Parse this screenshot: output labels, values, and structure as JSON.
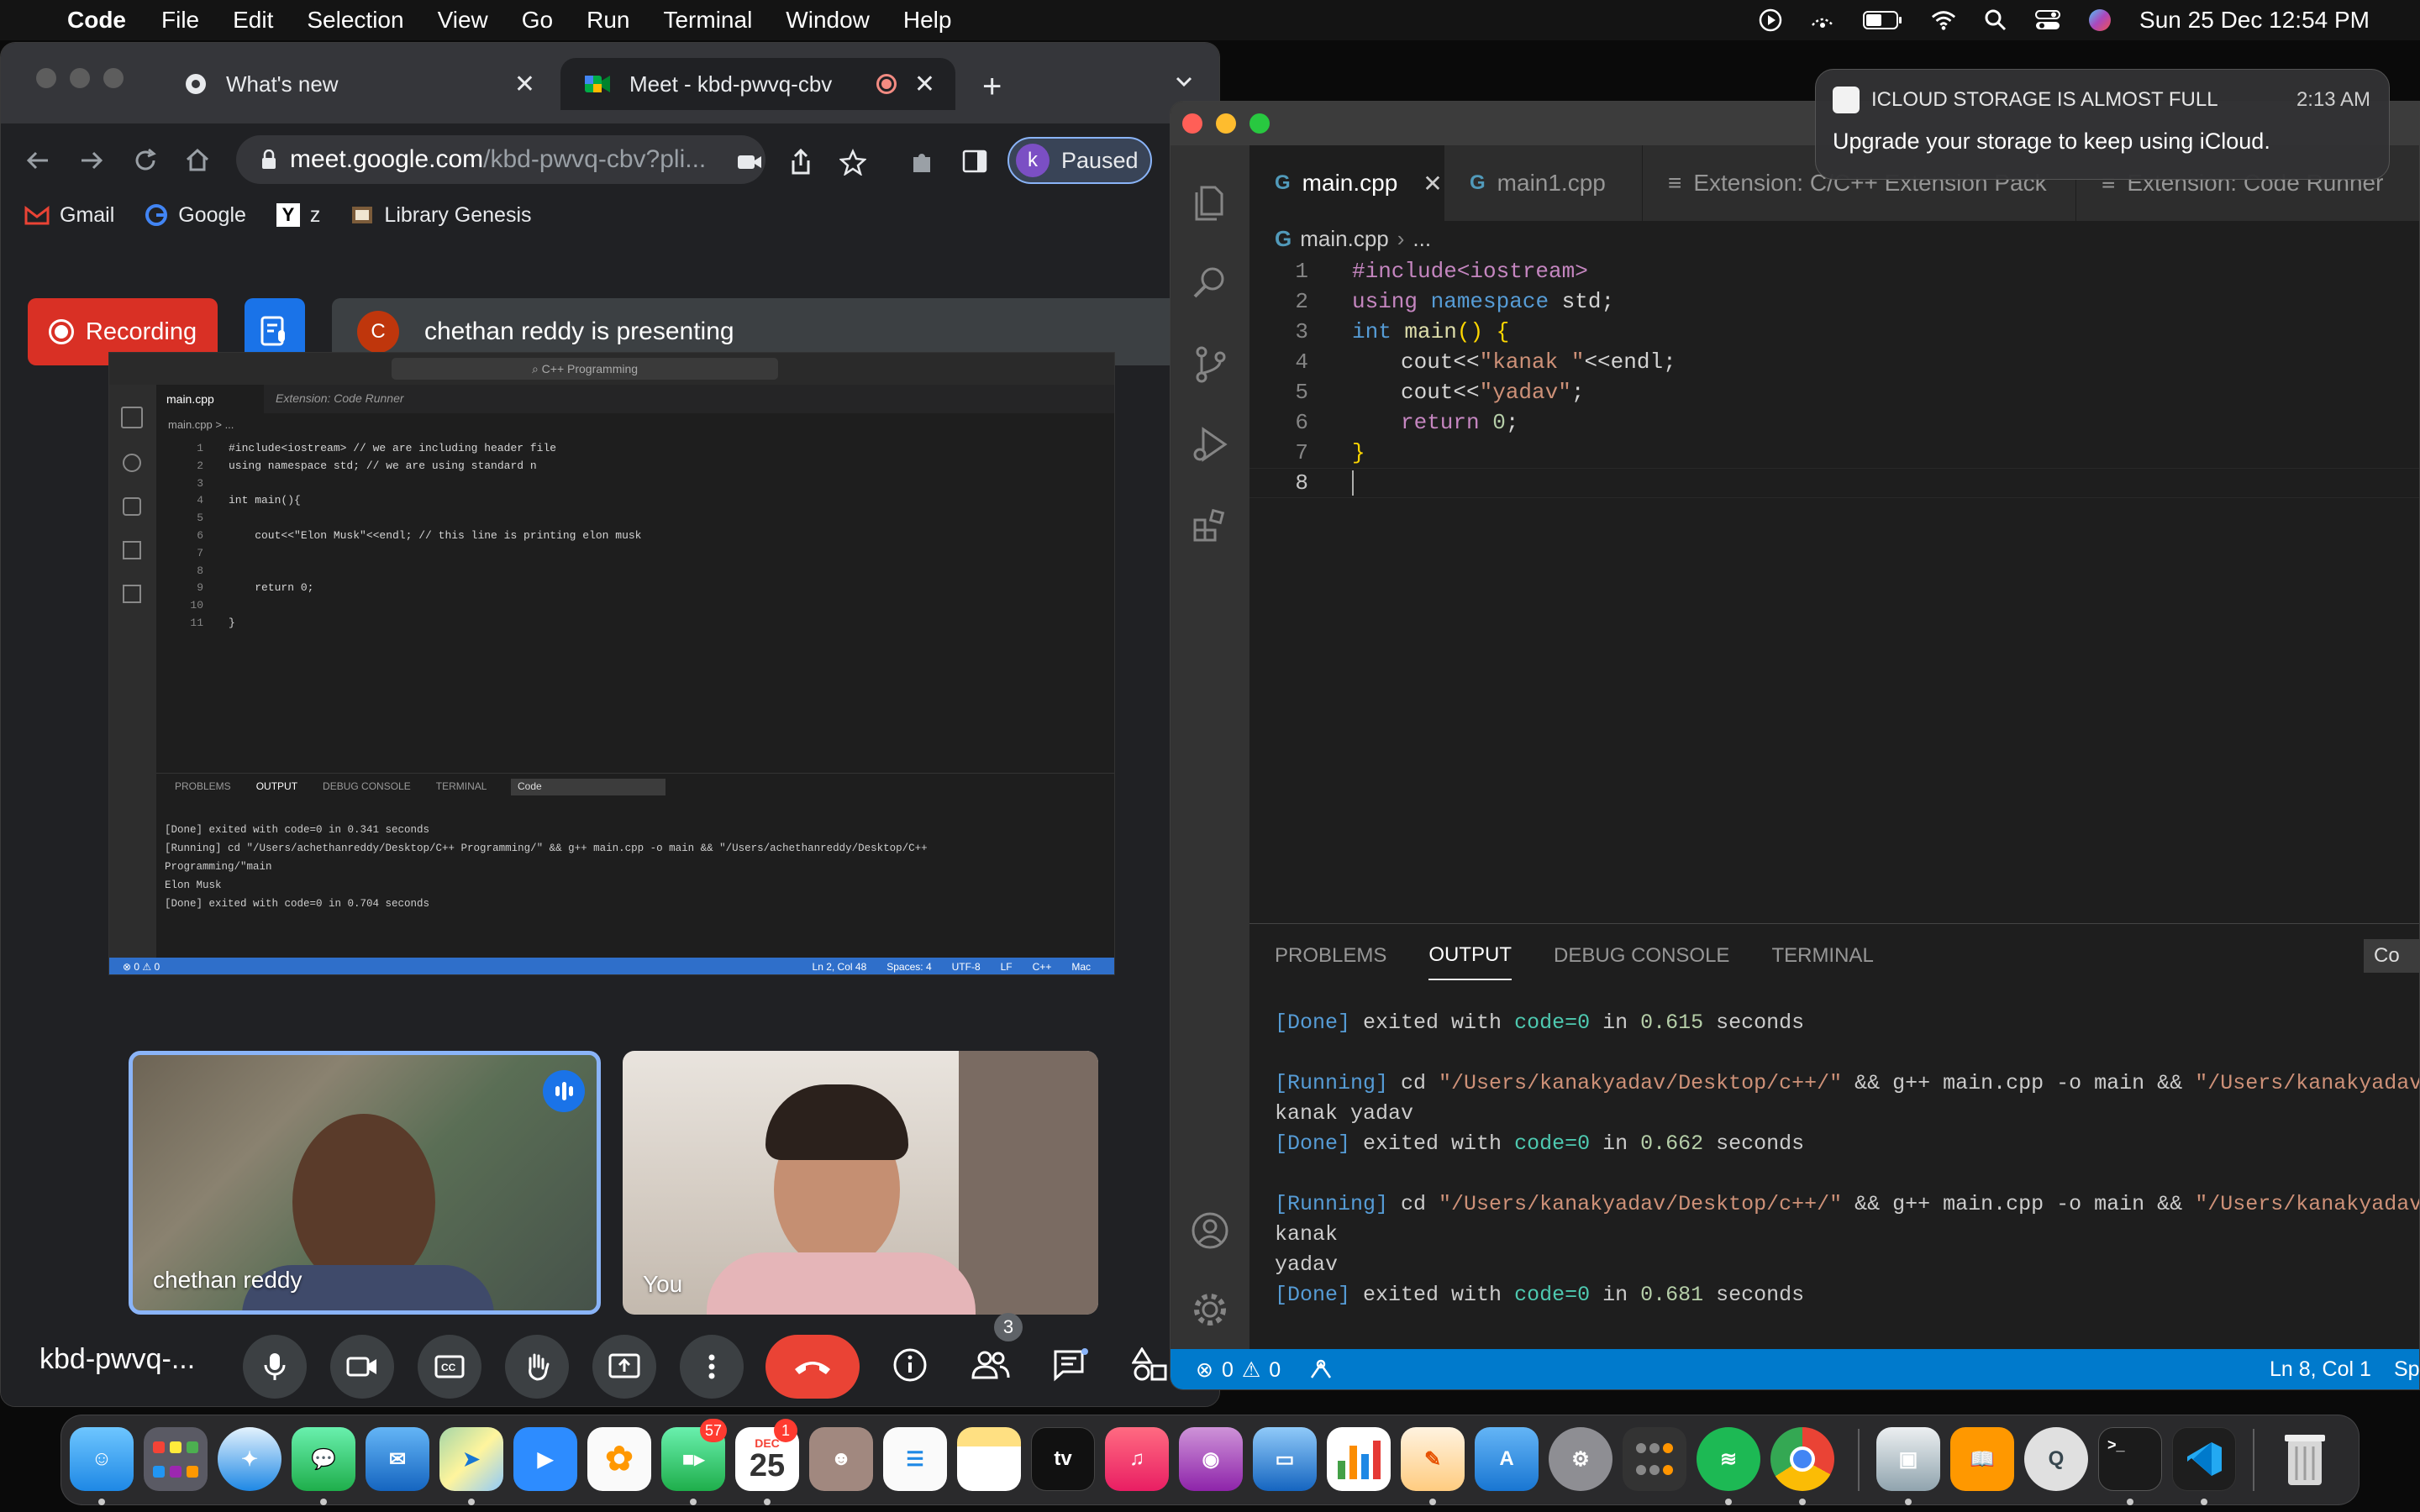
{
  "menubar": {
    "app": "Code",
    "items": [
      "File",
      "Edit",
      "Selection",
      "View",
      "Go",
      "Run",
      "Terminal",
      "Window",
      "Help"
    ],
    "datetime": "Sun 25 Dec  12:54 PM"
  },
  "chrome": {
    "tabs": [
      {
        "title": "What's new",
        "icon": "chrome-icon"
      },
      {
        "title": "Meet - kbd-pwvq-cbv",
        "icon": "meet-icon"
      }
    ],
    "url_host": "meet.google.com",
    "url_path": "/kbd-pwvq-cbv?pli...",
    "profile_initial": "k",
    "profile_label": "Paused",
    "bookmarks": [
      "Gmail",
      "Google",
      "z",
      "Library Genesis"
    ]
  },
  "meet": {
    "recording_label": "Recording",
    "presenter_initial": "C",
    "presenting_text": "chethan reddy is presenting",
    "meeting_code": "kbd-pwvq-...",
    "participants_count": "3",
    "tiles": [
      {
        "name": "chethan reddy"
      },
      {
        "name": "You"
      }
    ]
  },
  "shared_screen": {
    "search": "C++ Programming",
    "tabs": [
      "main.cpp",
      "Extension: Code Runner"
    ],
    "breadcrumb": "main.cpp > ...",
    "code_lines": [
      {
        "n": "1",
        "t": "#include<iostream> // we are including header file"
      },
      {
        "n": "2",
        "t": "using namespace std; // we are using standard n"
      },
      {
        "n": "3",
        "t": ""
      },
      {
        "n": "4",
        "t": "int main(){"
      },
      {
        "n": "5",
        "t": ""
      },
      {
        "n": "6",
        "t": "    cout<<\"Elon Musk\"<<endl; // this line is printing elon musk"
      },
      {
        "n": "7",
        "t": ""
      },
      {
        "n": "8",
        "t": ""
      },
      {
        "n": "9",
        "t": "    return 0;"
      },
      {
        "n": "10",
        "t": ""
      },
      {
        "n": "11",
        "t": "}"
      }
    ],
    "panel_tabs": [
      "PROBLEMS",
      "OUTPUT",
      "DEBUG CONSOLE",
      "TERMINAL"
    ],
    "panel_select": "Code",
    "output_lines": [
      "[Done] exited with code=0 in 0.341 seconds",
      "",
      "[Running] cd \"/Users/achethanreddy/Desktop/C++ Programming/\" && g++ main.cpp -o main && \"/Users/achethanreddy/Desktop/C++",
      "Programming/\"main",
      "Elon Musk",
      "",
      "[Done] exited with code=0 in 0.704 seconds"
    ],
    "status_left": "⊗ 0 ⚠ 0",
    "status_right": [
      "Ln 2, Col 48",
      "Spaces: 4",
      "UTF-8",
      "LF",
      "C++",
      "Mac"
    ]
  },
  "vscode": {
    "tabs": [
      "main.cpp",
      "main1.cpp",
      "Extension: C/C++ Extension Pack",
      "Extension: Code Runner"
    ],
    "breadcrumb_file": "main.cpp",
    "breadcrumb_rest": "...",
    "code": {
      "l1": "#include<iostream>",
      "l2_a": "using",
      "l2_b": "namespace",
      "l2_c": "std;",
      "l3_a": "int",
      "l3_b": "main",
      "l3_c": "() {",
      "l4_a": "cout<<",
      "l4_b": "\"kanak \"",
      "l4_c": "<<endl;",
      "l5_a": "cout<<",
      "l5_b": "\"yadav\"",
      "l5_c": ";",
      "l6_a": "return",
      "l6_b": "0",
      "l6_c": ";",
      "l7": "}"
    },
    "line_numbers": [
      "1",
      "2",
      "3",
      "4",
      "5",
      "6",
      "7",
      "8"
    ],
    "panel_tabs": [
      "PROBLEMS",
      "OUTPUT",
      "DEBUG CONSOLE",
      "TERMINAL"
    ],
    "panel_select": "Co",
    "output": {
      "o1_a": "[Done]",
      "o1_b": " exited with ",
      "o1_c": "code=0",
      "o1_d": " in ",
      "o1_e": "0.615",
      "o1_f": " seconds",
      "o2_a": "[Running]",
      "o2_b": " cd ",
      "o2_c": "\"/Users/kanakyadav/Desktop/c++/\"",
      "o2_d": " && g++ main.cpp -o main && ",
      "o2_e": "\"/Users/kanakyadav/De",
      "o3": "kanak yadav",
      "o4_a": "[Done]",
      "o4_b": " exited with ",
      "o4_c": "code=0",
      "o4_d": " in ",
      "o4_e": "0.662",
      "o4_f": " seconds",
      "o5_a": "[Running]",
      "o5_b": " cd ",
      "o5_c": "\"/Users/kanakyadav/Desktop/c++/\"",
      "o5_d": " && g++ main.cpp -o main && ",
      "o5_e": "\"/Users/kanakyadav/De",
      "o6": "kanak",
      "o7": "yadav",
      "o8_a": "[Done]",
      "o8_b": " exited with ",
      "o8_c": "code=0",
      "o8_d": " in ",
      "o8_e": "0.681",
      "o8_f": " seconds"
    },
    "status_errors": "0",
    "status_warnings": "0",
    "status_position": "Ln 8, Col 1",
    "status_spaces": "Sp"
  },
  "notification": {
    "title": "ICLOUD STORAGE IS ALMOST FULL",
    "time": "2:13 AM",
    "body": "Upgrade your storage to keep using iCloud."
  },
  "dock": {
    "facetime_badge": "57",
    "calendar_month": "DEC",
    "calendar_day": "25",
    "calendar_badge": "1",
    "tv_label": "tv"
  }
}
